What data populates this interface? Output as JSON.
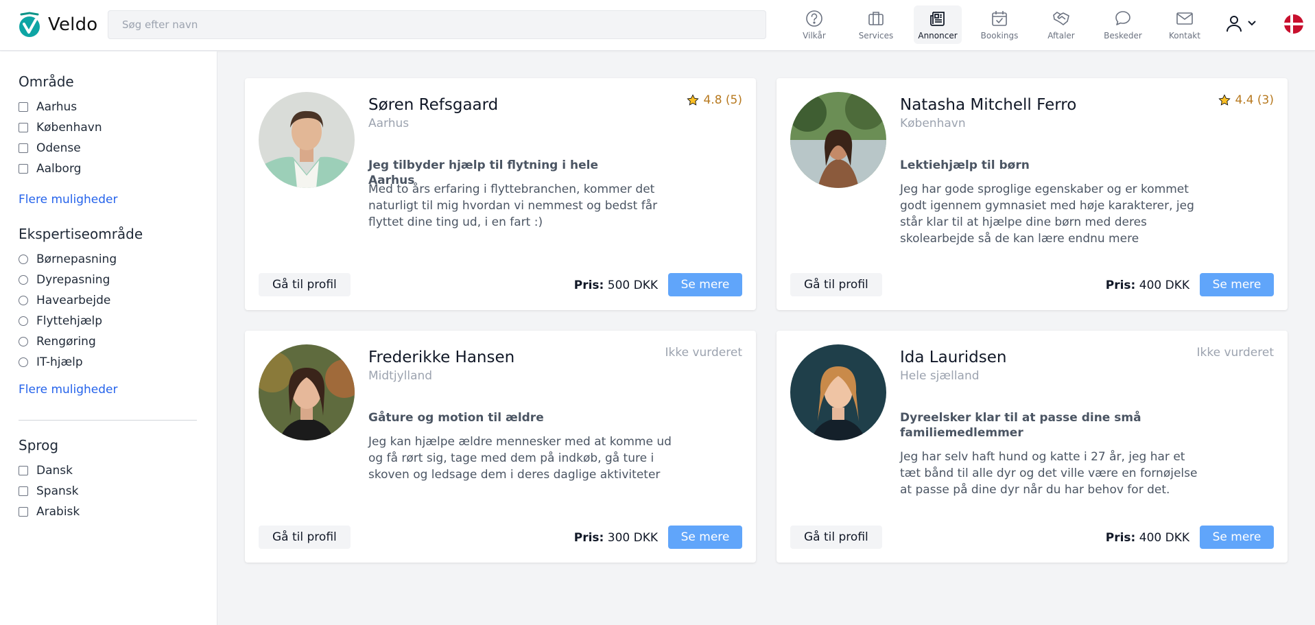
{
  "app": {
    "name": "Veldo",
    "logo_icon": "veldo-logo-icon"
  },
  "search": {
    "placeholder": "Søg efter navn",
    "value": ""
  },
  "nav": [
    {
      "label": "Vilkår",
      "icon": "question-circle-icon",
      "active": false
    },
    {
      "label": "Services",
      "icon": "briefcase-icon",
      "active": false
    },
    {
      "label": "Annoncer",
      "icon": "newspaper-icon",
      "active": true
    },
    {
      "label": "Bookings",
      "icon": "calendar-icon",
      "active": false
    },
    {
      "label": "Aftaler",
      "icon": "handshake-icon",
      "active": false
    },
    {
      "label": "Beskeder",
      "icon": "chat-bubble-icon",
      "active": false
    },
    {
      "label": "Kontakt",
      "icon": "envelope-icon",
      "active": false
    }
  ],
  "user_menu": {
    "icon": "user-icon",
    "caret": "chevron-down-icon"
  },
  "language": {
    "icon": "danish-flag-icon"
  },
  "filters": {
    "area": {
      "title": "Område",
      "options": [
        "Aarhus",
        "København",
        "Odense",
        "Aalborg"
      ],
      "more": "Flere muligheder"
    },
    "expertise": {
      "title": "Ekspertiseområde",
      "options": [
        "Børnepasning",
        "Dyrepasning",
        "Havearbejde",
        "Flyttehjælp",
        "Rengøring",
        "IT-hjælp"
      ],
      "more": "Flere muligheder"
    },
    "language": {
      "title": "Sprog",
      "options": [
        "Dansk",
        "Spansk",
        "Arabisk"
      ]
    }
  },
  "listings": [
    {
      "name": "Søren Refsgaard",
      "location": "Aarhus",
      "rating": "4.8 (5)",
      "title": "Jeg tilbyder hjælp til flytning i hele Aarhus",
      "description": "Med to års erfaring i flyttebranchen, kommer det naturligt til mig hvordan vi nemmest og bedst får flyttet dine ting ud, i en fart :)",
      "price_label": "Pris:",
      "price": "500 DKK",
      "profile_button": "Gå til profil",
      "more_button": "Se mere"
    },
    {
      "name": "Natasha Mitchell Ferro",
      "location": "København",
      "rating": "4.4 (3)",
      "title": "Lektiehjælp til børn",
      "description": "Jeg har gode sproglige egenskaber og er kommet godt igennem gymnasiet med høje karakterer, jeg står klar til at hjælpe dine børn med deres skolearbejde så de kan lære endnu mere",
      "price_label": "Pris:",
      "price": "400 DKK",
      "profile_button": "Gå til profil",
      "more_button": "Se mere"
    },
    {
      "name": "Frederikke Hansen",
      "location": "Midtjylland",
      "rating_text": "Ikke vurderet",
      "title": "Gåture og motion til ældre",
      "description": "Jeg kan hjælpe ældre mennesker med at komme ud og få rørt sig, tage med dem på indkøb, gå ture i skoven og ledsage dem i deres daglige aktiviteter",
      "price_label": "Pris:",
      "price": "300 DKK",
      "profile_button": "Gå til profil",
      "more_button": "Se mere"
    },
    {
      "name": "Ida Lauridsen",
      "location": "Hele sjælland",
      "rating_text": "Ikke vurderet",
      "title": "Dyreelsker klar til at passe dine små familiemedlemmer",
      "description": "Jeg har selv haft hund og katte i 27 år, jeg har et tæt bånd til alle dyr og det ville være en fornøjelse at passe på dine dyr når du har behov for det.",
      "price_label": "Pris:",
      "price": "400 DKK",
      "profile_button": "Gå til profil",
      "more_button": "Se mere"
    }
  ],
  "colors": {
    "accent": "#60a5fa",
    "link": "#2563eb",
    "rating": "#b7791f",
    "logo_teal": "#14b8a6"
  }
}
